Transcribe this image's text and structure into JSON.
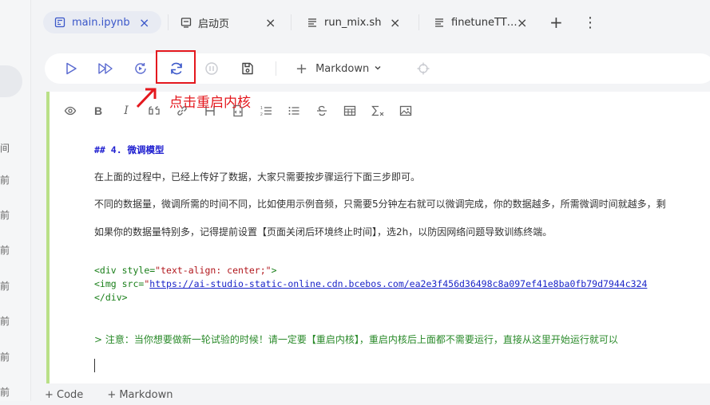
{
  "sidebar": {
    "items": [
      "间",
      "前",
      "前",
      "前",
      "前",
      "前",
      "前",
      "前"
    ]
  },
  "tabs": [
    {
      "label": "main.ipynb",
      "icon": "notebook-icon",
      "active": true
    },
    {
      "label": "启动页",
      "icon": "launcher-icon",
      "active": false
    },
    {
      "label": "run_mix.sh",
      "icon": "file-text-icon",
      "active": false
    },
    {
      "label": "finetuneTT…",
      "icon": "file-text-icon",
      "active": false
    }
  ],
  "tab_actions": {
    "new_tab": "+",
    "more": "⋮"
  },
  "toolbar": {
    "cell_type": "Markdown"
  },
  "annotation": {
    "text": "点击重启内核",
    "color": "#e4181e"
  },
  "editor": {
    "heading": "## 4. 微调模型",
    "p1": "在上面的过程中，已经上传好了数据，大家只需要按步骤运行下面三步即可。",
    "p2": "不同的数据量，微调所需的时间不同，比如使用示例音频，只需要5分钟左右就可以微调完成，你的数据越多，所需微调时间就越多，剩",
    "p3": "如果你的数据量特别多，记得提前设置【页面关闭后环境终止时间】，选2h，以防因网络问题导致训练终端。",
    "code": {
      "line1_tag": "<div",
      "line1_attr": " style=",
      "line1_str": "\"text-align: center;\"",
      "line1_end": ">",
      "line2_tag": "<img",
      "line2_attr": " src=",
      "line2_q": "\"",
      "line2_url": "https://ai-studio-static-online.cdn.bcebos.com/ea2e3f456d36498c8a097ef41e8ba0fb79d7944c324",
      "line3": "</div>"
    },
    "quote": "> 注意：当你想要做新一轮试验的时候！请一定要【重启内核】，重启内核后上面都不需要运行，直接从这里开始运行就可以"
  },
  "bottom": {
    "add_code": "+ Code",
    "add_markdown": "+ Markdown"
  },
  "colors": {
    "accent": "#3a57c9",
    "cell_border": "#b9e088",
    "annotation": "#e4181e"
  }
}
